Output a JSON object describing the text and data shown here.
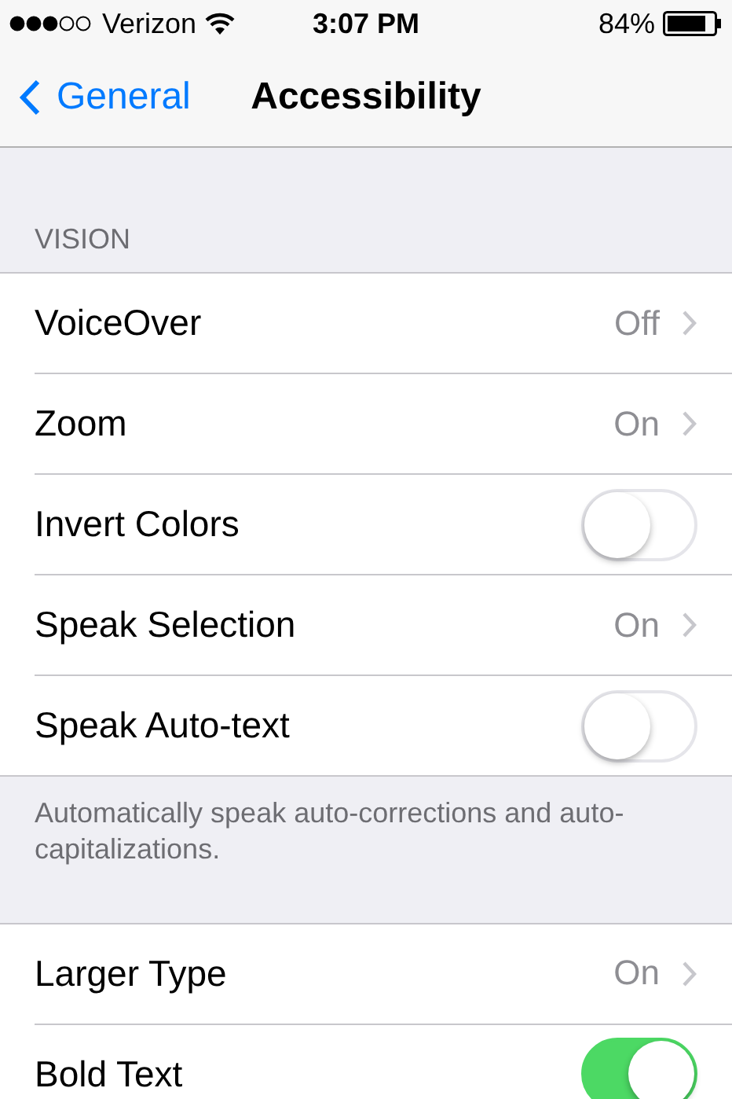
{
  "status_bar": {
    "carrier": "Verizon",
    "time": "3:07 PM",
    "battery": "84%"
  },
  "nav": {
    "back_label": "General",
    "title": "Accessibility"
  },
  "sections": [
    {
      "header": "VISION",
      "rows": [
        {
          "label": "VoiceOver",
          "kind": "link",
          "value": "Off"
        },
        {
          "label": "Zoom",
          "kind": "link",
          "value": "On"
        },
        {
          "label": "Invert Colors",
          "kind": "toggle",
          "on": false
        },
        {
          "label": "Speak Selection",
          "kind": "link",
          "value": "On"
        },
        {
          "label": "Speak Auto-text",
          "kind": "toggle",
          "on": false
        }
      ],
      "footer": "Automatically speak auto-corrections and auto-capitalizations."
    },
    {
      "rows": [
        {
          "label": "Larger Type",
          "kind": "link",
          "value": "On"
        },
        {
          "label": "Bold Text",
          "kind": "toggle",
          "on": true
        }
      ]
    }
  ]
}
